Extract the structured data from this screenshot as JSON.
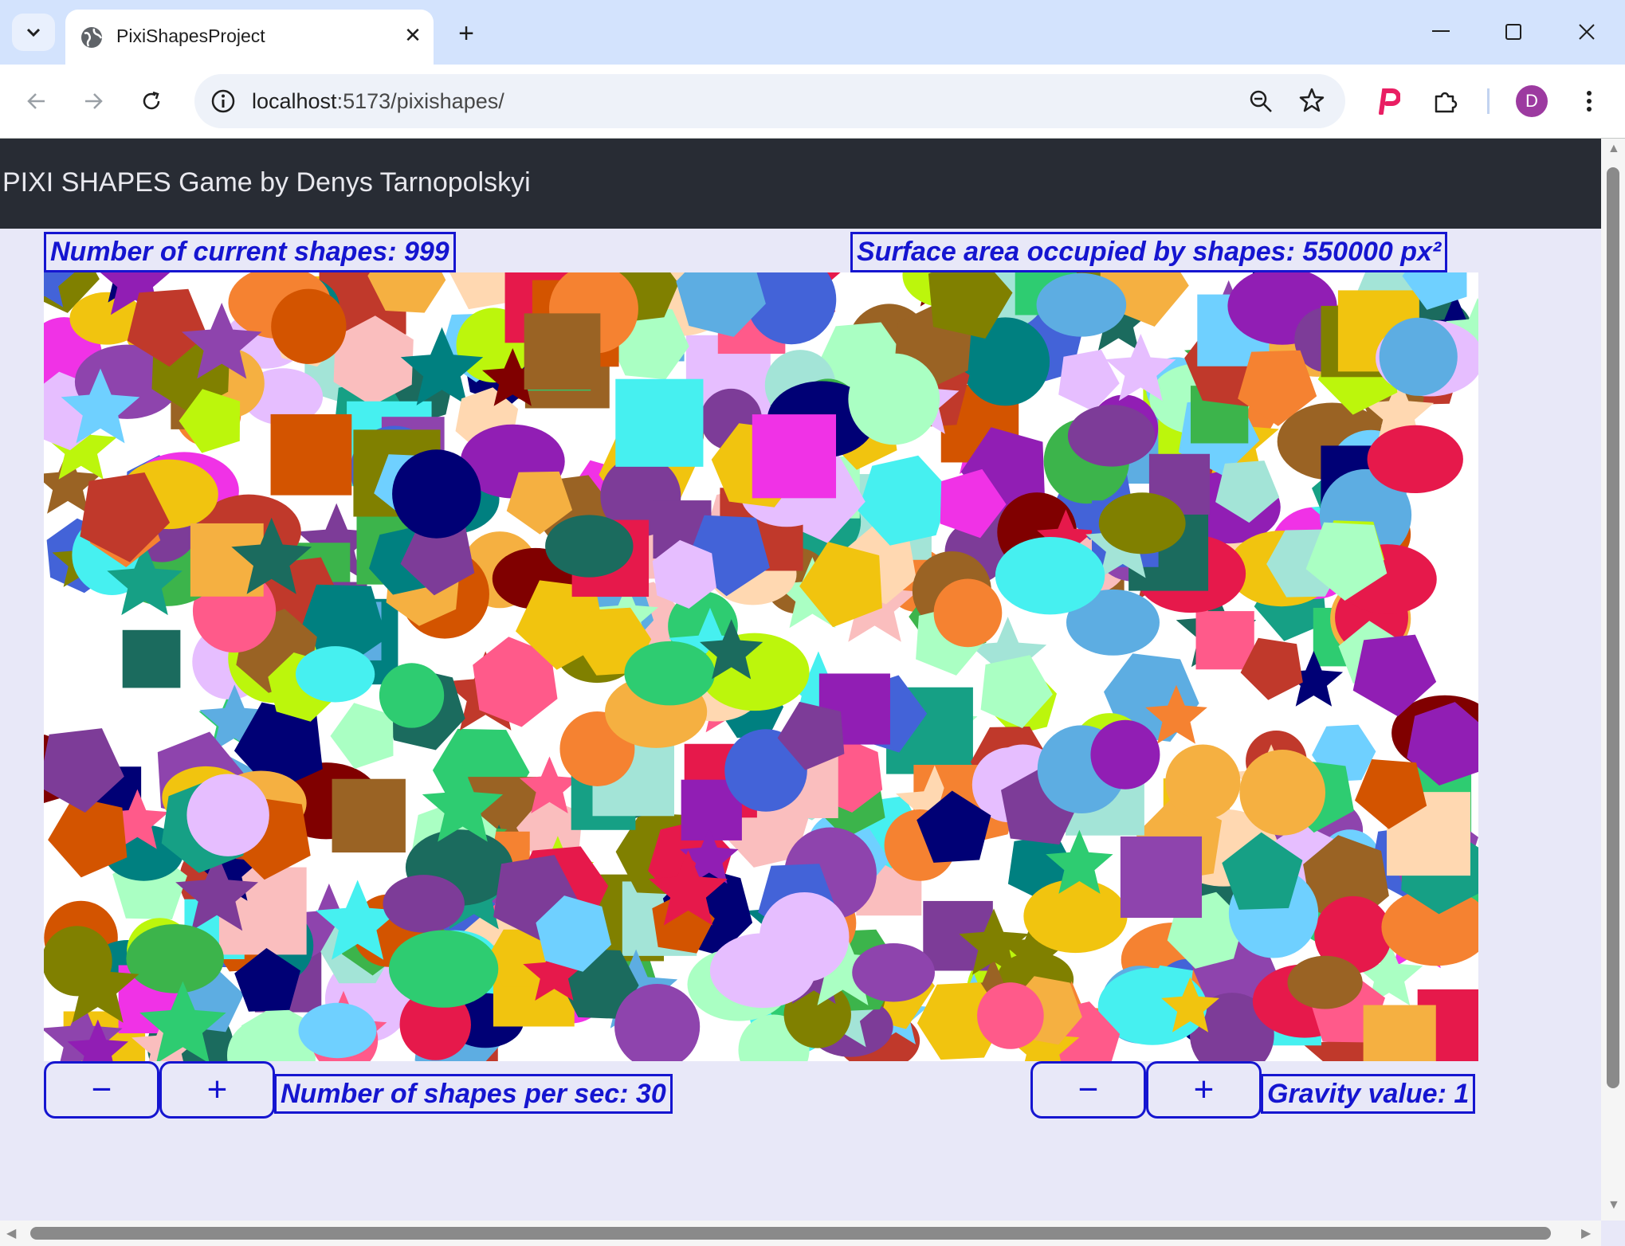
{
  "browser": {
    "tab_title": "PixiShapesProject",
    "url_host": "localhost",
    "url_rest": ":5173/pixishapes/",
    "profile_initial": "D"
  },
  "app": {
    "header_title": "PIXI SHAPES Game by Denys Tarnopolskyi",
    "shapes_count_label": "Number of current shapes: 999",
    "surface_area_label": "Surface area occupied by shapes: 550000 px²",
    "shapes_per_sec_label": "Number of shapes per sec: 30",
    "gravity_label": "Gravity value: 1",
    "minus_symbol": "−",
    "plus_symbol": "+"
  },
  "colors": {
    "accent": "#1515d0",
    "header_bg": "#282c34",
    "page_bg": "#e8e8f8",
    "shape_palette": [
      "#e6194b",
      "#3cb44b",
      "#4363d8",
      "#f58231",
      "#911eb4",
      "#46f0f0",
      "#f032e6",
      "#bcf60c",
      "#fabebe",
      "#008080",
      "#e6beff",
      "#9a6324",
      "#800000",
      "#aaffc3",
      "#808000",
      "#ffd8b1",
      "#000075",
      "#1b6b5e",
      "#ff5a8a",
      "#6fd0ff",
      "#2ecc71",
      "#c0392b",
      "#8e44ad",
      "#f1c40f",
      "#16a085",
      "#d35400",
      "#5dade2",
      "#a3e4d7",
      "#7d3c98",
      "#f5b041"
    ]
  }
}
